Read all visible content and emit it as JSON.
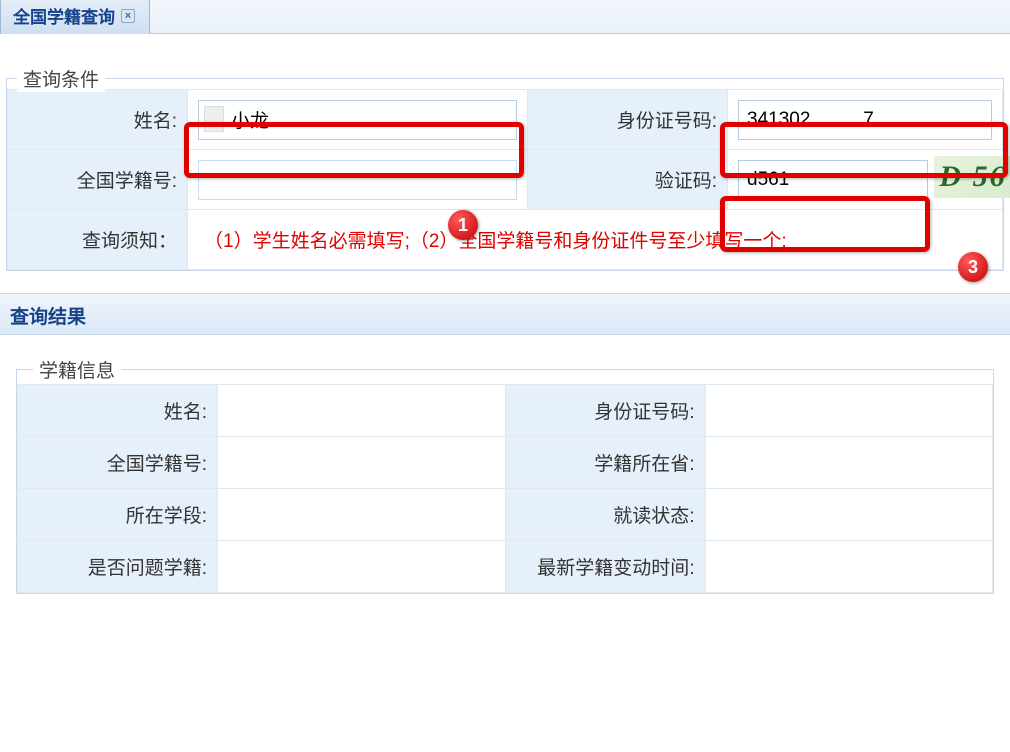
{
  "tab": {
    "title": "全国学籍查询"
  },
  "query": {
    "section_title": "查询条件",
    "labels": {
      "name": "姓名:",
      "id_number": "身份证号码:",
      "national_student_id": "全国学籍号:",
      "captcha": "验证码:",
      "notice": "查询须知："
    },
    "values": {
      "name": "小龙",
      "id_number_prefix": "341302",
      "id_number_suffix": "7",
      "national_student_id": "",
      "captcha_input": "d561",
      "captcha_image": "D 56"
    },
    "notice_text": "（1）学生姓名必需填写;（2）全国学籍号和身份证件号至少填写一个;"
  },
  "results": {
    "section_title": "查询结果",
    "info_section_title": "学籍信息",
    "labels": {
      "name": "姓名:",
      "id_number": "身份证号码:",
      "national_student_id": "全国学籍号:",
      "province": "学籍所在省:",
      "stage": "所在学段:",
      "status": "就读状态:",
      "problem": "是否问题学籍:",
      "last_change": "最新学籍变动时间:"
    },
    "values": {
      "name": "",
      "id_number": "",
      "national_student_id": "",
      "province": "",
      "stage": "",
      "status": "",
      "problem": "",
      "last_change": ""
    }
  },
  "annotations": {
    "badge1": "1",
    "badge3": "3"
  }
}
